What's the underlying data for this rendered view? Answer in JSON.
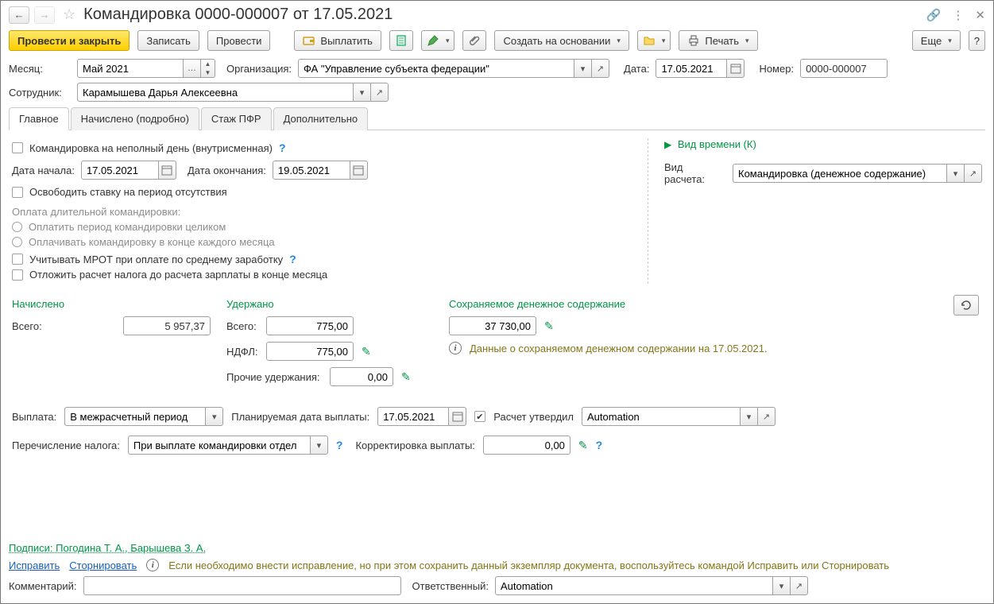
{
  "title": "Командировка 0000-000007 от 17.05.2021",
  "toolbar": {
    "post_close": "Провести и закрыть",
    "save": "Записать",
    "post": "Провести",
    "pay": "Выплатить",
    "create_based": "Создать на основании",
    "print": "Печать",
    "more": "Еще"
  },
  "header": {
    "month_lbl": "Месяц:",
    "month_val": "Май 2021",
    "org_lbl": "Организация:",
    "org_val": "ФА \"Управление субъекта федерации\"",
    "date_lbl": "Дата:",
    "date_val": "17.05.2021",
    "num_lbl": "Номер:",
    "num_val": "0000-000007",
    "emp_lbl": "Сотрудник:",
    "emp_val": "Карамышева Дарья Алексеевна"
  },
  "tabs": [
    "Главное",
    "Начислено (подробно)",
    "Стаж ПФР",
    "Дополнительно"
  ],
  "main": {
    "partday": "Командировка на неполный день (внутрисменная)",
    "start_lbl": "Дата начала:",
    "start_val": "17.05.2021",
    "end_lbl": "Дата окончания:",
    "end_val": "19.05.2021",
    "free_rate": "Освободить ставку на период отсутствия",
    "long_trip_hdr": "Оплата длительной командировки:",
    "opt_whole": "Оплатить период командировки целиком",
    "opt_monthly": "Оплачивать командировку в конце каждого месяца",
    "mrot": "Учитывать МРОТ при оплате по среднему заработку",
    "defer_tax": "Отложить расчет налога до расчета зарплаты в конце месяца",
    "time_kind": "Вид времени (К)",
    "calc_type_lbl": "Вид расчета:",
    "calc_type_val": "Командировка (денежное содержание)"
  },
  "totals": {
    "accrued_h": "Начислено",
    "withheld_h": "Удержано",
    "kept_h": "Сохраняемое денежное содержание",
    "total_lbl": "Всего:",
    "accrued_total": "5 957,37",
    "withheld_total": "775,00",
    "ndfl_lbl": "НДФЛ:",
    "ndfl_val": "775,00",
    "other_lbl": "Прочие удержания:",
    "other_val": "0,00",
    "kept_val": "37 730,00",
    "kept_info": "Данные о сохраняемом денежном содержании на 17.05.2021."
  },
  "payment": {
    "pay_lbl": "Выплата:",
    "pay_val": "В межрасчетный период",
    "plan_lbl": "Планируемая дата выплаты:",
    "plan_val": "17.05.2021",
    "approved_lbl": "Расчет утвердил",
    "approved_val": "Automation",
    "tax_transfer_lbl": "Перечисление налога:",
    "tax_transfer_val": "При выплате командировки отдел",
    "corr_lbl": "Корректировка выплаты:",
    "corr_val": "0,00"
  },
  "footer": {
    "sign": "Подписи: Погодина Т. А., Барышева З. А.",
    "fix": "Исправить",
    "storno": "Сторнировать",
    "fix_hint": "Если необходимо внести исправление, но при этом сохранить данный экземпляр документа, воспользуйтесь командой Исправить или Сторнировать",
    "comment_lbl": "Комментарий:",
    "resp_lbl": "Ответственный:",
    "resp_val": "Automation"
  }
}
